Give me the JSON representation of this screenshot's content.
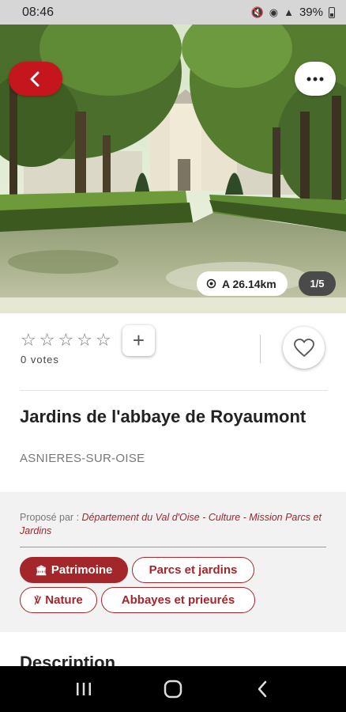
{
  "status_bar": {
    "time": "08:46",
    "battery": "39%"
  },
  "hero": {
    "distance": "A 26.14km",
    "photo_counter": "1/5"
  },
  "rating": {
    "star_count": 5,
    "votes": "0 votes",
    "add_label": "+"
  },
  "place": {
    "title": "Jardins de l'abbaye de Royaumont",
    "city": "ASNIERES-SUR-OISE"
  },
  "info": {
    "proposed_by_label": "Proposé par : ",
    "proposed_by_value": "Département du Val d'Oise - Culture - Mission Parcs et Jardins",
    "tags": [
      {
        "label": "Patrimoine",
        "icon": "monument-icon",
        "selected": true
      },
      {
        "label": "Parcs et jardins",
        "icon": "",
        "selected": false
      },
      {
        "label": "Nature",
        "icon": "plant-icon",
        "selected": false
      },
      {
        "label": "Abbayes et prieurés",
        "icon": "",
        "selected": false
      }
    ]
  },
  "description": {
    "title": "Description"
  },
  "colors": {
    "accent": "#c4161c",
    "tag": "#a3262b"
  }
}
